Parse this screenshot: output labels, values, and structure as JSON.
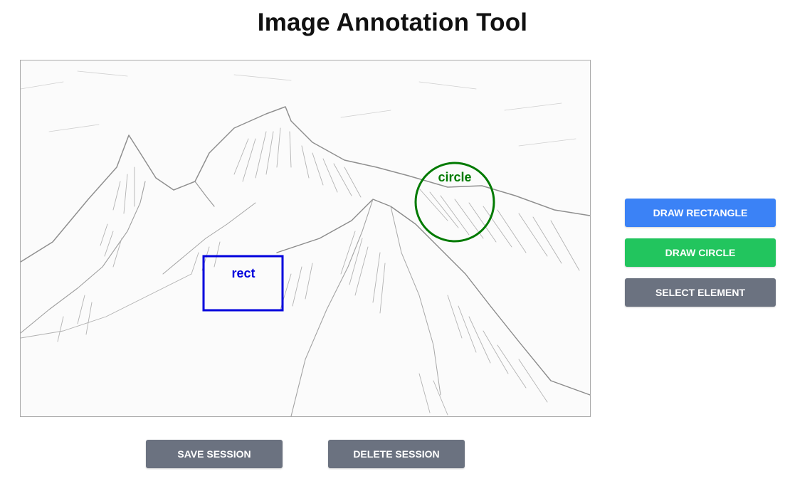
{
  "header": {
    "title": "Image Annotation Tool"
  },
  "canvas": {
    "annotations": [
      {
        "type": "rect",
        "label": "rect",
        "color": "#0000dd"
      },
      {
        "type": "circle",
        "label": "circle",
        "color": "#007a00"
      }
    ]
  },
  "toolbar": {
    "draw_rectangle_label": "Draw Rectangle",
    "draw_rectangle_color": "#3b82f6",
    "draw_circle_label": "Draw Circle",
    "draw_circle_color": "#22c55e",
    "select_element_label": "Select Element",
    "select_element_color": "#6b7280"
  },
  "session": {
    "save_label": "Save Session",
    "delete_label": "Delete Session",
    "button_color": "#6b7280"
  }
}
